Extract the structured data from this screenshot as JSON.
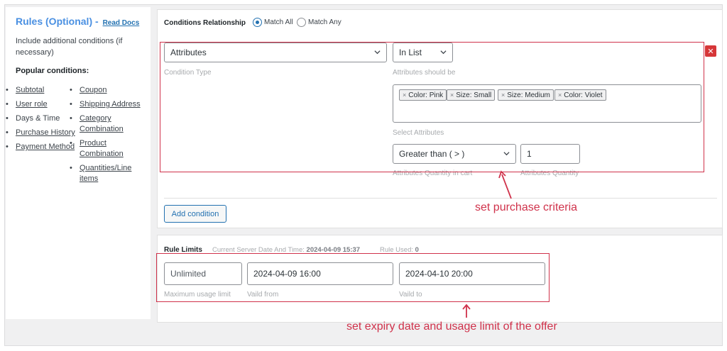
{
  "sidebar": {
    "title": "Rules (Optional)",
    "title_sep": "-",
    "read_docs": "Read Docs",
    "description": "Include additional conditions (if necessary)",
    "popular_heading": "Popular conditions:",
    "col1": [
      "Subtotal",
      "User role",
      "Days & Time",
      "Purchase History",
      "Payment Method"
    ],
    "col1_underlined": [
      true,
      true,
      false,
      true,
      true
    ],
    "col2": [
      "Coupon",
      "Shipping Address",
      "Category Combination",
      "Product Combination",
      "Quantities/Line items"
    ]
  },
  "conditions": {
    "relationship_label": "Conditions Relationship",
    "match_all": "Match All",
    "match_any": "Match Any",
    "selected": "Match All",
    "condition_type_value": "Attributes",
    "condition_type_label": "Condition Type",
    "operator_value": "In List",
    "operator_label": "Attributes should be",
    "tags": [
      "Color: Pink",
      "Size: Small",
      "Size: Medium",
      "Color: Violet"
    ],
    "tags_label": "Select Attributes",
    "qty_operator_value": "Greater than ( > )",
    "qty_operator_label": "Attributes Quantity in cart",
    "qty_value": "1",
    "qty_label": "Attributes Quantity",
    "delete_icon": "close-icon",
    "add_condition": "Add condition"
  },
  "rule_limits": {
    "label": "Rule Limits",
    "server_time_label": "Current Server Date And Time:",
    "server_time_value": "2024-04-09 15:37",
    "rule_used_label": "Rule Used:",
    "rule_used_value": "0",
    "usage_limit_value": "Unlimited",
    "usage_limit_label": "Maximum usage limit",
    "valid_from_value": "2024-04-09 16:00",
    "valid_from_label": "Vaild from",
    "valid_to_value": "2024-04-10 20:00",
    "valid_to_label": "Vaild to"
  },
  "annotations": {
    "purchase": "set purchase criteria",
    "expiry": "set expiry date and usage limit of the offer"
  },
  "colors": {
    "accent": "#2271b1",
    "title": "#4a90e2",
    "annotation": "#d0324b",
    "delete": "#d63638"
  }
}
